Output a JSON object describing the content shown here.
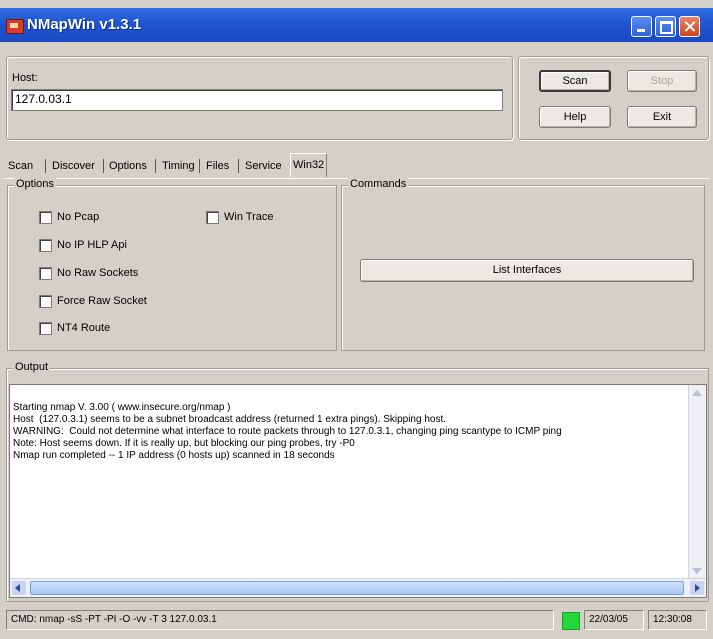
{
  "window": {
    "title": "NMapWin v1.3.1",
    "accent": "#1f55d0"
  },
  "host": {
    "label": "Host:",
    "value": "127.0.03.1"
  },
  "buttons": {
    "scan": "Scan",
    "stop": "Stop",
    "help": "Help",
    "exit": "Exit"
  },
  "tabs": [
    "Scan",
    "Discover",
    "Options",
    "Timing",
    "Files",
    "Service",
    "Win32"
  ],
  "active_tab": "Win32",
  "win32": {
    "options_title": "Options",
    "commands_title": "Commands",
    "checkboxes": {
      "no_pcap": "No Pcap",
      "win_trace": "Win Trace",
      "no_ip_hlp_api": "No IP HLP Api",
      "no_raw_sockets": "No Raw Sockets",
      "force_raw_socket": "Force Raw Socket",
      "nt4_route": "NT4 Route"
    },
    "list_interfaces": "List Interfaces"
  },
  "output": {
    "title": "Output",
    "lines": [
      "Starting nmap V. 3.00 ( www.insecure.org/nmap )",
      "Host  (127.0.3.1) seems to be a subnet broadcast address (returned 1 extra pings). Skipping host.",
      "WARNING:  Could not determine what interface to route packets through to 127.0.3.1, changing ping scantype to ICMP ping",
      "Note: Host seems down. If it is really up, but blocking our ping probes, try -P0",
      "Nmap run completed -- 1 IP address (0 hosts up) scanned in 18 seconds"
    ]
  },
  "status": {
    "cmd": "CMD: nmap -sS -PT -PI -O -vv -T 3 127.0.03.1",
    "indicator_color": "#22d83a",
    "date": "22/03/05",
    "time": "12:30:08"
  }
}
